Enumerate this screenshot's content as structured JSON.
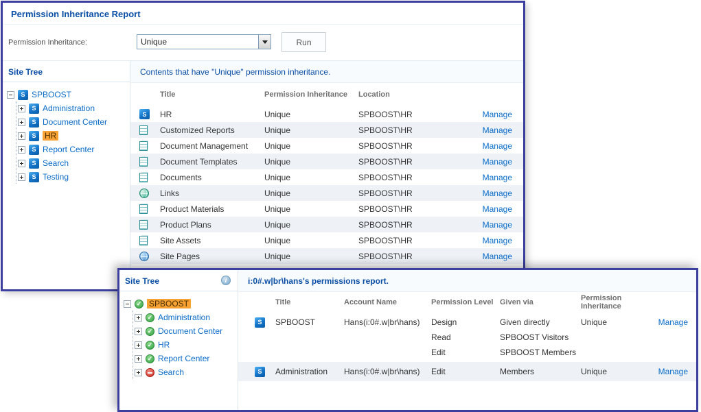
{
  "icons": {
    "sp_glyph": "S",
    "info_glyph": "i"
  },
  "back": {
    "title": "Permission Inheritance Report",
    "form": {
      "label": "Permission Inheritance:",
      "dropdown_value": "Unique",
      "run": "Run"
    },
    "tree": {
      "header": "Site Tree",
      "root": "SPBOOST",
      "items": [
        {
          "label": "Administration"
        },
        {
          "label": "Document Center"
        },
        {
          "label": "HR"
        },
        {
          "label": "Report Center"
        },
        {
          "label": "Search"
        },
        {
          "label": "Testing"
        }
      ]
    },
    "table": {
      "caption": "Contents that have \"Unique\" permission inheritance.",
      "headers": {
        "title": "Title",
        "inheritance": "Permission Inheritance",
        "location": "Location"
      },
      "manage": "Manage",
      "rows": [
        {
          "title": "HR",
          "inheritance": "Unique",
          "location": "SPBOOST\\HR"
        },
        {
          "title": "Customized Reports",
          "inheritance": "Unique",
          "location": "SPBOOST\\HR"
        },
        {
          "title": "Document Management",
          "inheritance": "Unique",
          "location": "SPBOOST\\HR"
        },
        {
          "title": "Document Templates",
          "inheritance": "Unique",
          "location": "SPBOOST\\HR"
        },
        {
          "title": "Documents",
          "inheritance": "Unique",
          "location": "SPBOOST\\HR"
        },
        {
          "title": "Links",
          "inheritance": "Unique",
          "location": "SPBOOST\\HR"
        },
        {
          "title": "Product Materials",
          "inheritance": "Unique",
          "location": "SPBOOST\\HR"
        },
        {
          "title": "Product Plans",
          "inheritance": "Unique",
          "location": "SPBOOST\\HR"
        },
        {
          "title": "Site Assets",
          "inheritance": "Unique",
          "location": "SPBOOST\\HR"
        },
        {
          "title": "Site Pages",
          "inheritance": "Unique",
          "location": "SPBOOST\\HR"
        }
      ]
    }
  },
  "front": {
    "tree": {
      "header": "Site Tree",
      "root": "SPBOOST",
      "items": [
        {
          "label": "Administration"
        },
        {
          "label": "Document Center"
        },
        {
          "label": "HR"
        },
        {
          "label": "Report Center"
        },
        {
          "label": "Search"
        }
      ]
    },
    "table": {
      "caption": "i:0#.w|br\\hans's permissions report.",
      "headers": {
        "title": "Title",
        "account": "Account Name",
        "level": "Permission Level",
        "given": "Given via",
        "inheritance": "Permission Inheritance"
      },
      "manage": "Manage",
      "rows": [
        {
          "title": "SPBOOST",
          "account": "Hans(i:0#.w|br\\hans)",
          "levels": [
            "Design",
            "Read",
            "Edit"
          ],
          "given": [
            "Given directly",
            "SPBOOST Visitors",
            "SPBOOST Members"
          ],
          "inheritance": "Unique"
        },
        {
          "title": "Administration",
          "account": "Hans(i:0#.w|br\\hans)",
          "levels": [
            "Edit"
          ],
          "given": [
            "Members"
          ],
          "inheritance": "Unique"
        }
      ]
    }
  }
}
